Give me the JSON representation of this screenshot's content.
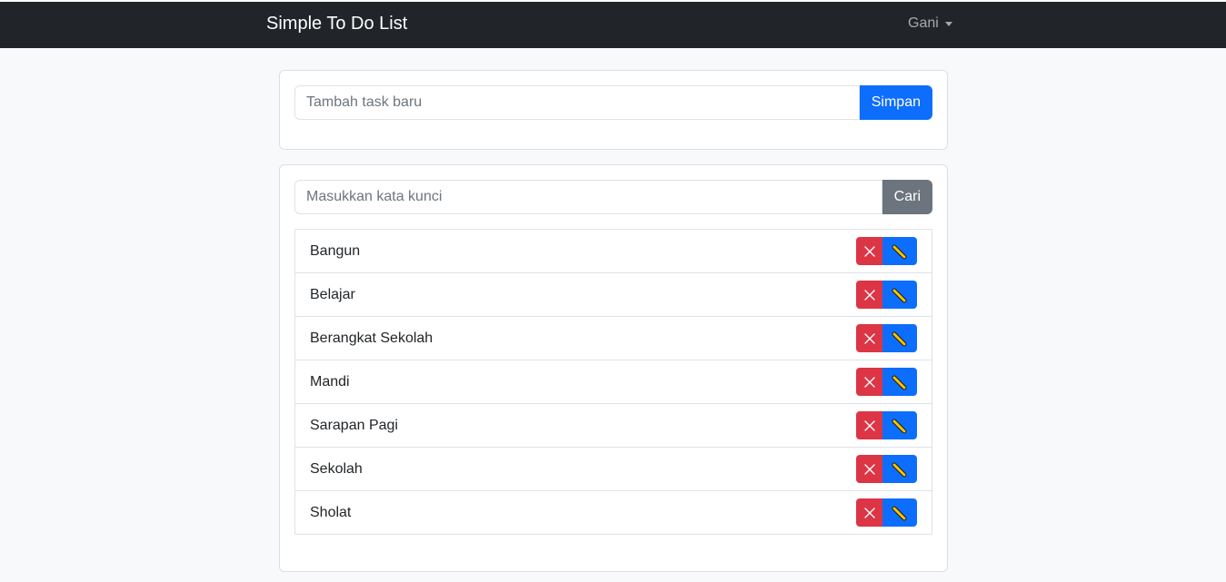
{
  "navbar": {
    "brand": "Simple To Do List",
    "user_name": "Gani"
  },
  "add_task": {
    "placeholder": "Tambah task baru",
    "value": "",
    "button_label": "Simpan"
  },
  "search": {
    "placeholder": "Masukkan kata kunci",
    "value": "",
    "button_label": "Cari"
  },
  "tasks": [
    {
      "label": "Bangun"
    },
    {
      "label": "Belajar"
    },
    {
      "label": "Berangkat Sekolah"
    },
    {
      "label": "Mandi"
    },
    {
      "label": "Sarapan Pagi"
    },
    {
      "label": "Sekolah"
    },
    {
      "label": "Sholat"
    }
  ],
  "icons": {
    "delete": "close-icon",
    "edit": "pencil-icon"
  },
  "colors": {
    "navbar_bg": "#212529",
    "primary": "#0d6efd",
    "danger": "#dc3545",
    "secondary": "#6c757d",
    "page_bg": "#f8f9fa"
  }
}
